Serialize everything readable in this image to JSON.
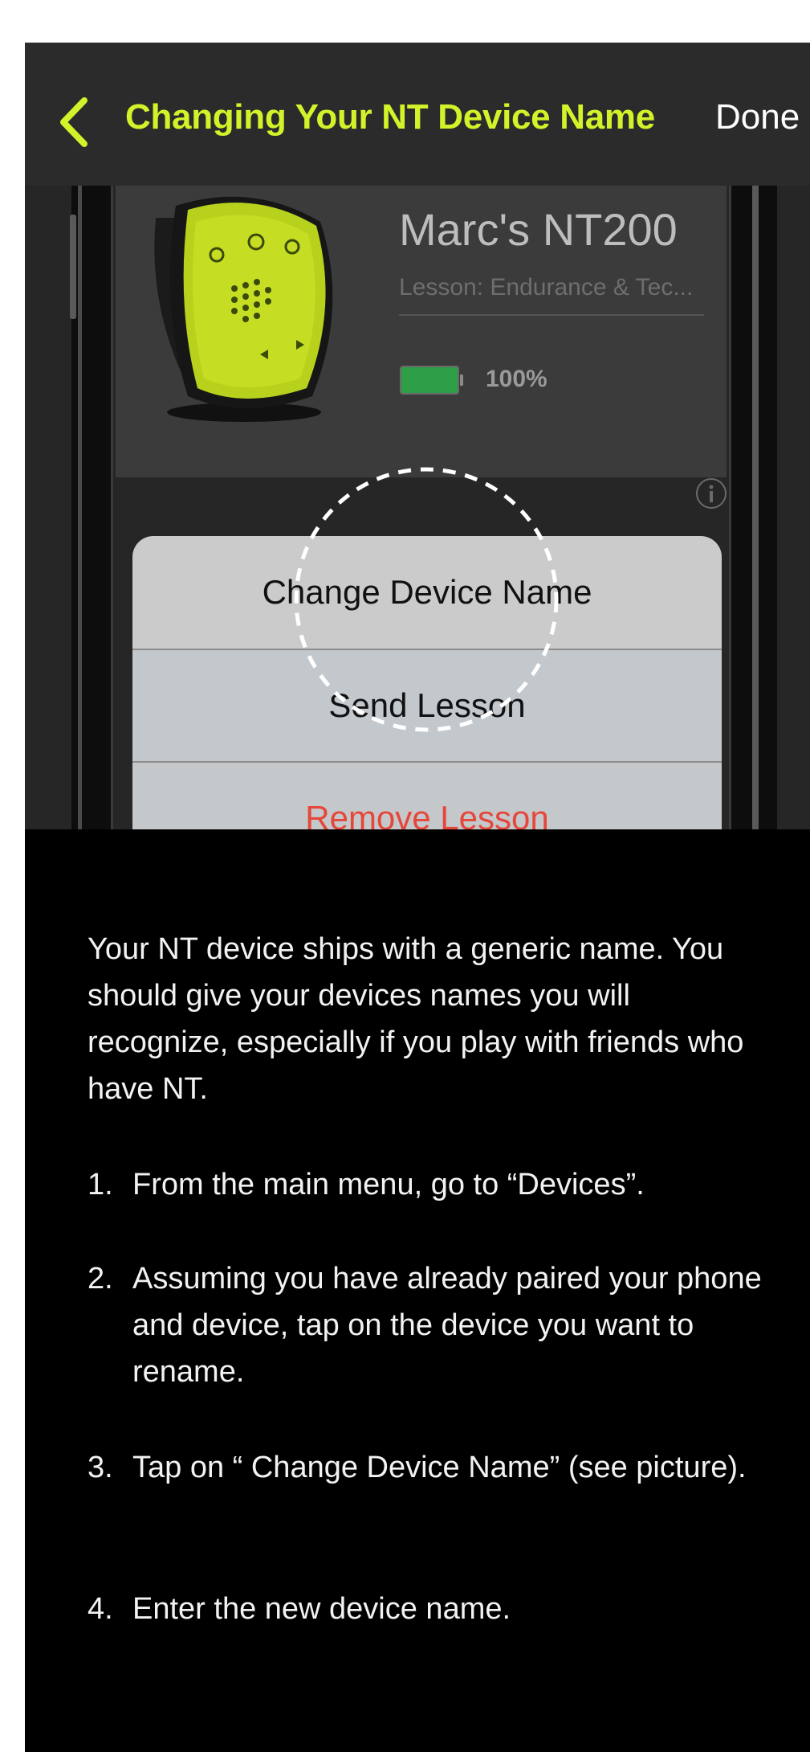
{
  "header": {
    "title": "Changing Your NT Device Name",
    "done_label": "Done"
  },
  "device": {
    "name": "Marc's NT200",
    "lesson": "Lesson: Endurance & Tec...",
    "battery_percent_label": "100%",
    "battery_level": 1.0
  },
  "action_sheet": {
    "items": [
      {
        "label": "Change Device Name"
      },
      {
        "label": "Send Lesson"
      },
      {
        "label": "Remove Lesson"
      }
    ]
  },
  "colors": {
    "accent": "#d4f22a",
    "destructive": "#e5473b",
    "battery": "#2e9e48"
  },
  "instructions": {
    "intro": "Your NT device ships with a generic name. You should give your devices names you will recognize, especially if you play with friends who have NT.",
    "steps": [
      {
        "num": "1.",
        "text": "From the main menu, go to “Devices”."
      },
      {
        "num": "2.",
        "text": "Assuming you have already paired your phone and device, tap on the device you want to rename."
      },
      {
        "num": "3.",
        "text": "Tap on “ Change Device Name” (see picture)."
      },
      {
        "num": "4.",
        "text": "Enter the new device name."
      }
    ]
  }
}
